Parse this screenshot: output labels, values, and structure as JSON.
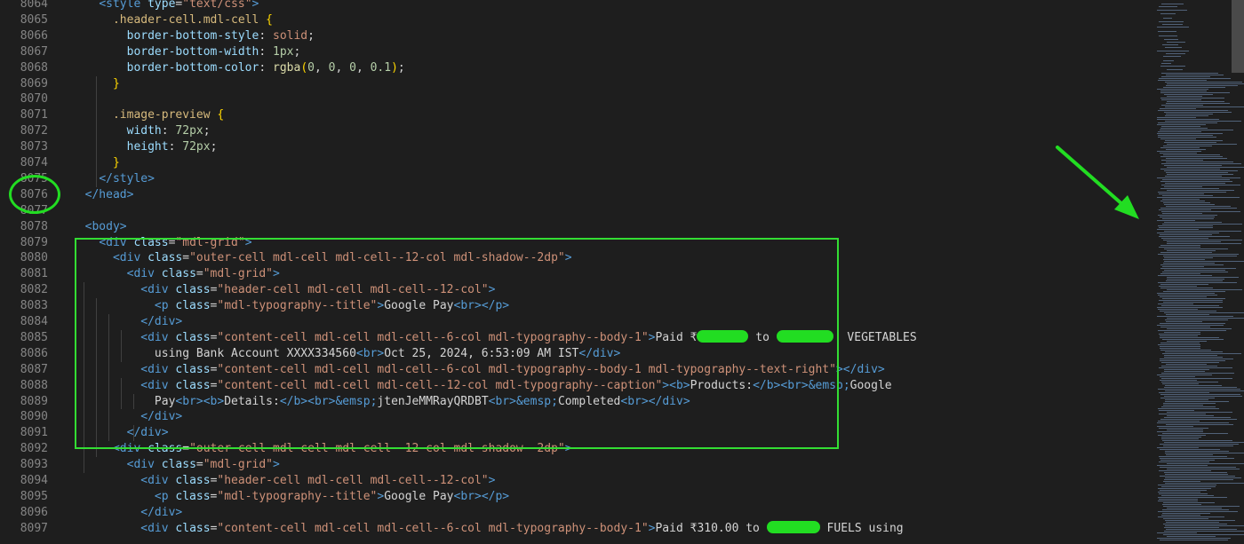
{
  "editor": {
    "lines": [
      {
        "n": "8064",
        "parts": [
          [
            "sp",
            "    "
          ],
          [
            "tag",
            "<style"
          ],
          [
            "txt",
            " "
          ],
          [
            "attr",
            "type"
          ],
          [
            "txt",
            "="
          ],
          [
            "str",
            "\"text/css\""
          ],
          [
            "tag",
            ">"
          ]
        ]
      },
      {
        "n": "8065",
        "parts": [
          [
            "sp",
            "      "
          ],
          [
            "sel",
            ".header-cell.mdl-cell"
          ],
          [
            "txt",
            " "
          ],
          [
            "brace",
            "{"
          ]
        ]
      },
      {
        "n": "8066",
        "parts": [
          [
            "sp",
            "        "
          ],
          [
            "prop",
            "border-bottom-style"
          ],
          [
            "txt",
            ": "
          ],
          [
            "val",
            "solid"
          ],
          [
            "txt",
            ";"
          ]
        ]
      },
      {
        "n": "8067",
        "parts": [
          [
            "sp",
            "        "
          ],
          [
            "prop",
            "border-bottom-width"
          ],
          [
            "txt",
            ": "
          ],
          [
            "num",
            "1px"
          ],
          [
            "txt",
            ";"
          ]
        ]
      },
      {
        "n": "8068",
        "parts": [
          [
            "sp",
            "        "
          ],
          [
            "prop",
            "border-bottom-color"
          ],
          [
            "txt",
            ": "
          ],
          [
            "fn",
            "rgba"
          ],
          [
            "brace",
            "("
          ],
          [
            "num",
            "0"
          ],
          [
            "txt",
            ", "
          ],
          [
            "num",
            "0"
          ],
          [
            "txt",
            ", "
          ],
          [
            "num",
            "0"
          ],
          [
            "txt",
            ", "
          ],
          [
            "num",
            "0.1"
          ],
          [
            "brace",
            ")"
          ],
          [
            "txt",
            ";"
          ]
        ]
      },
      {
        "n": "8069",
        "parts": [
          [
            "sp",
            "      "
          ],
          [
            "brace",
            "}"
          ]
        ]
      },
      {
        "n": "8070",
        "parts": []
      },
      {
        "n": "8071",
        "parts": [
          [
            "sp",
            "      "
          ],
          [
            "sel",
            ".image-preview"
          ],
          [
            "txt",
            " "
          ],
          [
            "brace",
            "{"
          ]
        ]
      },
      {
        "n": "8072",
        "parts": [
          [
            "sp",
            "        "
          ],
          [
            "prop",
            "width"
          ],
          [
            "txt",
            ": "
          ],
          [
            "num",
            "72px"
          ],
          [
            "txt",
            ";"
          ]
        ]
      },
      {
        "n": "8073",
        "parts": [
          [
            "sp",
            "        "
          ],
          [
            "prop",
            "height"
          ],
          [
            "txt",
            ": "
          ],
          [
            "num",
            "72px"
          ],
          [
            "txt",
            ";"
          ]
        ]
      },
      {
        "n": "8074",
        "parts": [
          [
            "sp",
            "      "
          ],
          [
            "brace",
            "}"
          ]
        ]
      },
      {
        "n": "8075",
        "parts": [
          [
            "sp",
            "    "
          ],
          [
            "tag",
            "</style>"
          ]
        ]
      },
      {
        "n": "8076",
        "parts": [
          [
            "sp",
            "  "
          ],
          [
            "tag",
            "</head>"
          ]
        ]
      },
      {
        "n": "8077",
        "parts": []
      },
      {
        "n": "8078",
        "parts": [
          [
            "sp",
            "  "
          ],
          [
            "tag",
            "<body>"
          ]
        ]
      },
      {
        "n": "8079",
        "parts": [
          [
            "sp",
            "    "
          ],
          [
            "tag",
            "<div"
          ],
          [
            "txt",
            " "
          ],
          [
            "attr",
            "class"
          ],
          [
            "txt",
            "="
          ],
          [
            "str",
            "\"mdl-grid\""
          ],
          [
            "tag",
            ">"
          ]
        ]
      },
      {
        "n": "8080",
        "parts": [
          [
            "sp",
            "      "
          ],
          [
            "tag",
            "<div"
          ],
          [
            "txt",
            " "
          ],
          [
            "attr",
            "class"
          ],
          [
            "txt",
            "="
          ],
          [
            "str",
            "\"outer-cell mdl-cell mdl-cell--12-col mdl-shadow--2dp\""
          ],
          [
            "tag",
            ">"
          ]
        ]
      },
      {
        "n": "8081",
        "parts": [
          [
            "sp",
            "        "
          ],
          [
            "tag",
            "<div"
          ],
          [
            "txt",
            " "
          ],
          [
            "attr",
            "class"
          ],
          [
            "txt",
            "="
          ],
          [
            "str",
            "\"mdl-grid\""
          ],
          [
            "tag",
            ">"
          ]
        ]
      },
      {
        "n": "8082",
        "parts": [
          [
            "sp",
            "          "
          ],
          [
            "tag",
            "<div"
          ],
          [
            "txt",
            " "
          ],
          [
            "attr",
            "class"
          ],
          [
            "txt",
            "="
          ],
          [
            "str",
            "\"header-cell mdl-cell mdl-cell--12-col\""
          ],
          [
            "tag",
            ">"
          ]
        ]
      },
      {
        "n": "8083",
        "parts": [
          [
            "sp",
            "            "
          ],
          [
            "tag",
            "<p"
          ],
          [
            "txt",
            " "
          ],
          [
            "attr",
            "class"
          ],
          [
            "txt",
            "="
          ],
          [
            "str",
            "\"mdl-typography--title\""
          ],
          [
            "tag",
            ">"
          ],
          [
            "txt",
            "Google Pay"
          ],
          [
            "tag",
            "<br>"
          ],
          [
            "tag",
            "</p>"
          ]
        ]
      },
      {
        "n": "8084",
        "parts": [
          [
            "sp",
            "          "
          ],
          [
            "tag",
            "</div>"
          ]
        ]
      },
      {
        "n": "8085",
        "parts": [
          [
            "sp",
            "          "
          ],
          [
            "tag",
            "<div"
          ],
          [
            "txt",
            " "
          ],
          [
            "attr",
            "class"
          ],
          [
            "txt",
            "="
          ],
          [
            "str",
            "\"content-cell mdl-cell mdl-cell--6-col mdl-typography--body-1\""
          ],
          [
            "tag",
            ">"
          ],
          [
            "txt",
            "Paid ₹"
          ],
          [
            "redact",
            "58"
          ],
          [
            "txt",
            " to "
          ],
          [
            "redact",
            "64"
          ],
          [
            "txt",
            "  VEGETABLES"
          ]
        ]
      },
      {
        "n": "8086",
        "parts": [
          [
            "sp",
            "            "
          ],
          [
            "txt",
            "using Bank Account XXXX334560"
          ],
          [
            "tag",
            "<br>"
          ],
          [
            "txt",
            "Oct 25, 2024, 6:53:09 AM IST"
          ],
          [
            "tag",
            "</div>"
          ]
        ]
      },
      {
        "n": "8087",
        "parts": [
          [
            "sp",
            "          "
          ],
          [
            "tag",
            "<div"
          ],
          [
            "txt",
            " "
          ],
          [
            "attr",
            "class"
          ],
          [
            "txt",
            "="
          ],
          [
            "str",
            "\"content-cell mdl-cell mdl-cell--6-col mdl-typography--body-1 mdl-typography--text-right\""
          ],
          [
            "tag",
            "></div>"
          ]
        ]
      },
      {
        "n": "8088",
        "parts": [
          [
            "sp",
            "          "
          ],
          [
            "tag",
            "<div"
          ],
          [
            "txt",
            " "
          ],
          [
            "attr",
            "class"
          ],
          [
            "txt",
            "="
          ],
          [
            "str",
            "\"content-cell mdl-cell mdl-cell--12-col mdl-typography--caption\""
          ],
          [
            "tag",
            ">"
          ],
          [
            "tag",
            "<b>"
          ],
          [
            "txt",
            "Products:"
          ],
          [
            "tag",
            "</b>"
          ],
          [
            "tag",
            "<br>"
          ],
          [
            "ent",
            "&emsp;"
          ],
          [
            "txt",
            "Google"
          ]
        ]
      },
      {
        "n": "8089",
        "parts": [
          [
            "sp",
            "            "
          ],
          [
            "txt",
            "Pay"
          ],
          [
            "tag",
            "<br>"
          ],
          [
            "tag",
            "<b>"
          ],
          [
            "txt",
            "Details:"
          ],
          [
            "tag",
            "</b>"
          ],
          [
            "tag",
            "<br>"
          ],
          [
            "ent",
            "&emsp;"
          ],
          [
            "txt",
            "jtenJeMMRayQRDBT"
          ],
          [
            "tag",
            "<br>"
          ],
          [
            "ent",
            "&emsp;"
          ],
          [
            "txt",
            "Completed"
          ],
          [
            "tag",
            "<br>"
          ],
          [
            "tag",
            "</div>"
          ]
        ]
      },
      {
        "n": "8090",
        "parts": [
          [
            "sp",
            "          "
          ],
          [
            "tag",
            "</div>"
          ]
        ]
      },
      {
        "n": "8091",
        "parts": [
          [
            "sp",
            "        "
          ],
          [
            "tag",
            "</div>"
          ]
        ]
      },
      {
        "n": "8092",
        "parts": [
          [
            "sp",
            "      "
          ],
          [
            "tag",
            "<div"
          ],
          [
            "txt",
            " "
          ],
          [
            "attr",
            "class"
          ],
          [
            "txt",
            "="
          ],
          [
            "str",
            "\"outer-cell mdl-cell mdl-cell--12-col mdl-shadow--2dp\""
          ],
          [
            "tag",
            ">"
          ]
        ]
      },
      {
        "n": "8093",
        "parts": [
          [
            "sp",
            "        "
          ],
          [
            "tag",
            "<div"
          ],
          [
            "txt",
            " "
          ],
          [
            "attr",
            "class"
          ],
          [
            "txt",
            "="
          ],
          [
            "str",
            "\"mdl-grid\""
          ],
          [
            "tag",
            ">"
          ]
        ]
      },
      {
        "n": "8094",
        "parts": [
          [
            "sp",
            "          "
          ],
          [
            "tag",
            "<div"
          ],
          [
            "txt",
            " "
          ],
          [
            "attr",
            "class"
          ],
          [
            "txt",
            "="
          ],
          [
            "str",
            "\"header-cell mdl-cell mdl-cell--12-col\""
          ],
          [
            "tag",
            ">"
          ]
        ]
      },
      {
        "n": "8095",
        "parts": [
          [
            "sp",
            "            "
          ],
          [
            "tag",
            "<p"
          ],
          [
            "txt",
            " "
          ],
          [
            "attr",
            "class"
          ],
          [
            "txt",
            "="
          ],
          [
            "str",
            "\"mdl-typography--title\""
          ],
          [
            "tag",
            ">"
          ],
          [
            "txt",
            "Google Pay"
          ],
          [
            "tag",
            "<br>"
          ],
          [
            "tag",
            "</p>"
          ]
        ]
      },
      {
        "n": "8096",
        "parts": [
          [
            "sp",
            "          "
          ],
          [
            "tag",
            "</div>"
          ]
        ]
      },
      {
        "n": "8097",
        "parts": [
          [
            "sp",
            "          "
          ],
          [
            "tag",
            "<div"
          ],
          [
            "txt",
            " "
          ],
          [
            "attr",
            "class"
          ],
          [
            "txt",
            "="
          ],
          [
            "str",
            "\"content-cell mdl-cell mdl-cell--6-col mdl-typography--body-1\""
          ],
          [
            "tag",
            ">"
          ],
          [
            "txt",
            "Paid ₹310.00 to "
          ],
          [
            "redact",
            "60"
          ],
          [
            "txt",
            " FUELS using"
          ]
        ]
      }
    ]
  },
  "colors": {
    "background": "#1e1e1e",
    "annotation_green": "#22dd22",
    "tag": "#569cd6",
    "attribute": "#9cdcfe",
    "string": "#ce9178",
    "selector": "#d7ba7d",
    "number": "#b5cea8"
  },
  "annotations": {
    "circle_icon": "circle-annotation",
    "arrow_icon": "arrow-annotation",
    "box_icon": "highlight-box"
  }
}
